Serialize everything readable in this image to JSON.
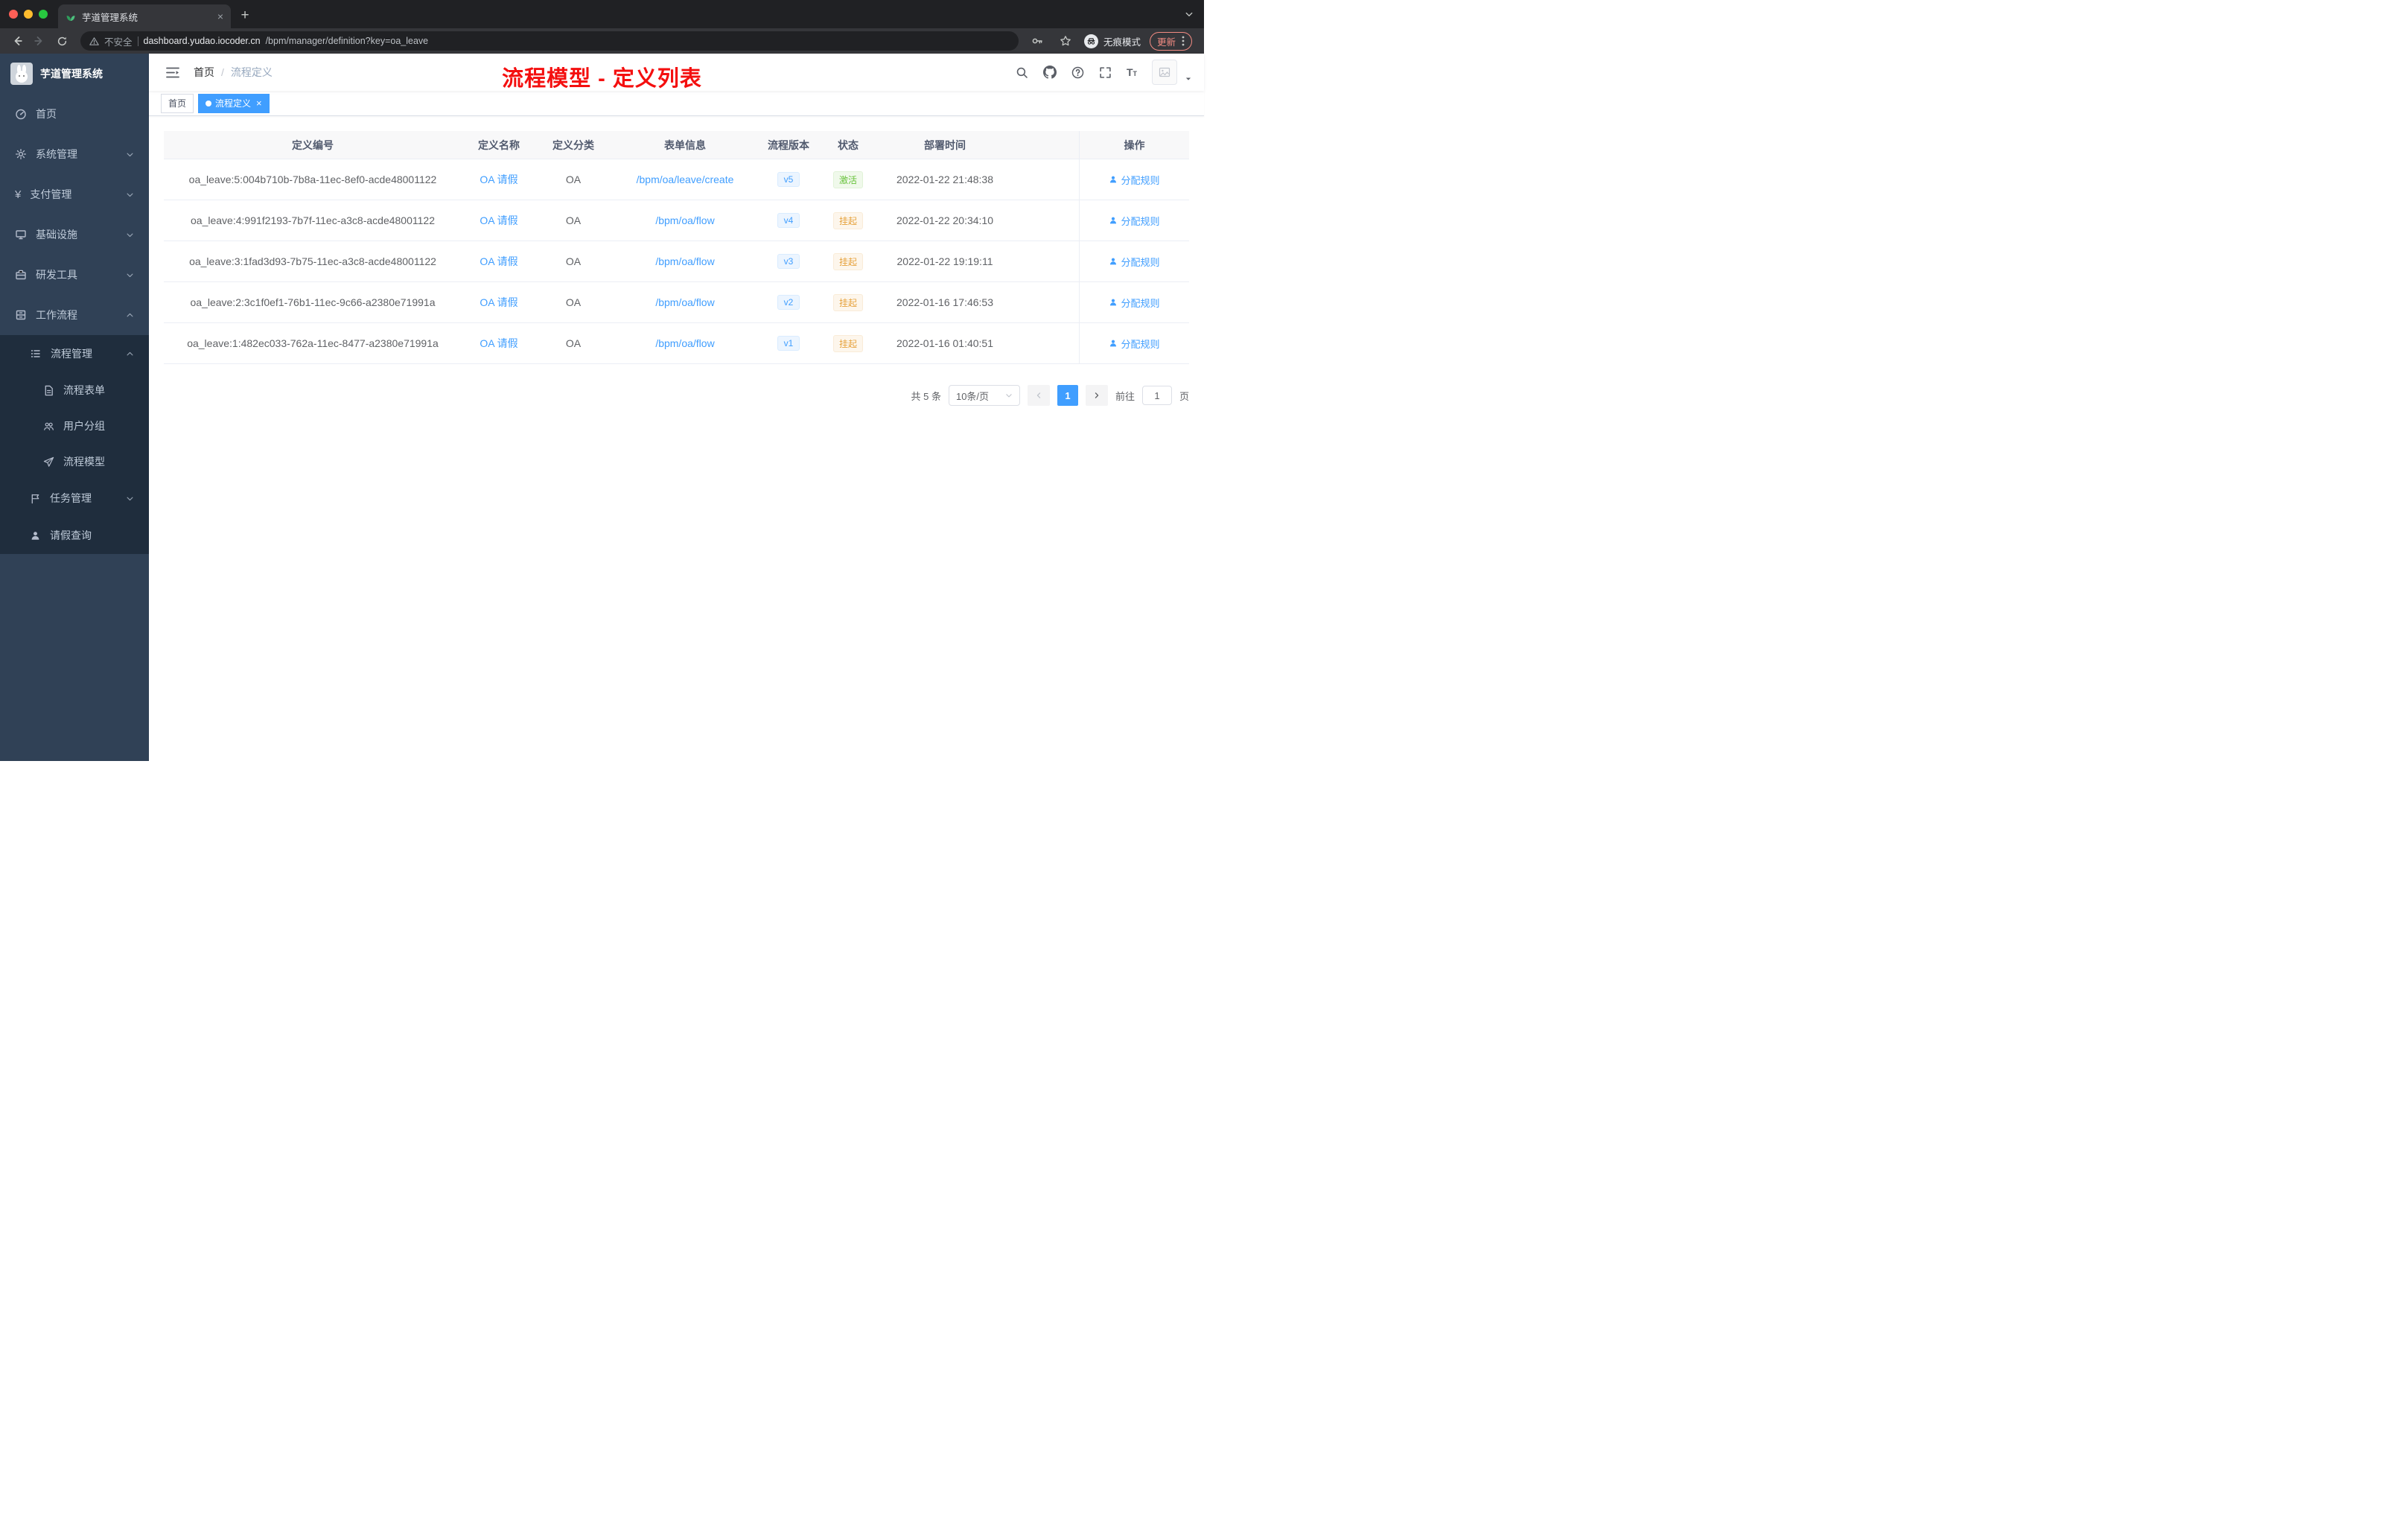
{
  "colors": {
    "primary": "#409EFF",
    "success": "#67C23A",
    "warning": "#E6A23C",
    "sidebar_bg": "#304156",
    "submenu_bg": "#1F2D3D",
    "annotation_red": "#F40F0F"
  },
  "browser": {
    "tab_title": "芋道管理系统",
    "security_label": "不安全",
    "url_host": "dashboard.yudao.iocoder.cn",
    "url_path": "/bpm/manager/definition?key=oa_leave",
    "incognito_label": "无痕模式",
    "update_label": "更新"
  },
  "sidebar": {
    "brand": "芋道管理系统",
    "items": [
      {
        "label": "首页"
      },
      {
        "label": "系统管理"
      },
      {
        "label": "支付管理"
      },
      {
        "label": "基础设施"
      },
      {
        "label": "研发工具"
      },
      {
        "label": "工作流程"
      }
    ],
    "submenu": {
      "process": {
        "label": "流程管理",
        "children": [
          {
            "label": "流程表单"
          },
          {
            "label": "用户分组"
          },
          {
            "label": "流程模型"
          }
        ]
      },
      "task": {
        "label": "任务管理"
      },
      "leave": {
        "label": "请假查询"
      }
    }
  },
  "navbar": {
    "breadcrumb_home": "首页",
    "breadcrumb_sep": "/",
    "breadcrumb_current": "流程定义",
    "annotation": "流程模型 - 定义列表"
  },
  "tags": {
    "home": "首页",
    "current": "流程定义"
  },
  "table": {
    "columns": [
      "定义编号",
      "定义名称",
      "定义分类",
      "表单信息",
      "流程版本",
      "状态",
      "部署时间",
      "操作"
    ],
    "rows": [
      {
        "id": "oa_leave:5:004b710b-7b8a-11ec-8ef0-acde48001122",
        "name": "OA 请假",
        "category": "OA",
        "form": "/bpm/oa/leave/create",
        "version": "v5",
        "status": "激活",
        "status_type": "success",
        "time": "2022-01-22 21:48:38",
        "action": "分配规则"
      },
      {
        "id": "oa_leave:4:991f2193-7b7f-11ec-a3c8-acde48001122",
        "name": "OA 请假",
        "category": "OA",
        "form": "/bpm/oa/flow",
        "version": "v4",
        "status": "挂起",
        "status_type": "warning",
        "time": "2022-01-22 20:34:10",
        "action": "分配规则"
      },
      {
        "id": "oa_leave:3:1fad3d93-7b75-11ec-a3c8-acde48001122",
        "name": "OA 请假",
        "category": "OA",
        "form": "/bpm/oa/flow",
        "version": "v3",
        "status": "挂起",
        "status_type": "warning",
        "time": "2022-01-22 19:19:11",
        "action": "分配规则"
      },
      {
        "id": "oa_leave:2:3c1f0ef1-76b1-11ec-9c66-a2380e71991a",
        "name": "OA 请假",
        "category": "OA",
        "form": "/bpm/oa/flow",
        "version": "v2",
        "status": "挂起",
        "status_type": "warning",
        "time": "2022-01-16 17:46:53",
        "action": "分配规则"
      },
      {
        "id": "oa_leave:1:482ec033-762a-11ec-8477-a2380e71991a",
        "name": "OA 请假",
        "category": "OA",
        "form": "/bpm/oa/flow",
        "version": "v1",
        "status": "挂起",
        "status_type": "warning",
        "time": "2022-01-16 01:40:51",
        "action": "分配规则"
      }
    ]
  },
  "pagination": {
    "total_label": "共 5 条",
    "page_size": "10条/页",
    "current_page": "1",
    "goto_label": "前往",
    "goto_value": "1",
    "page_unit": "页"
  }
}
